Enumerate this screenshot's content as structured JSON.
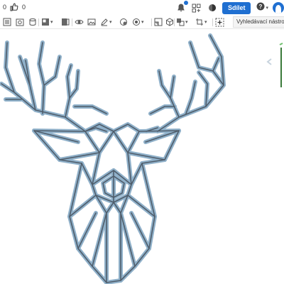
{
  "topbar": {
    "like_count": "0",
    "share_label": "Sdílet",
    "brand_color": "#1f6fd1"
  },
  "toolbar": {
    "search_tool_label": "Vyhledávací nástroje..."
  },
  "canvas": {
    "subject": "geometric deer head line drawing",
    "stroke_color": "#5d6f80",
    "fill_color": "#8fb0c9"
  }
}
